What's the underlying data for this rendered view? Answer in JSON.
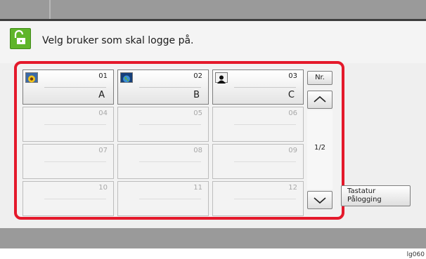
{
  "header": {
    "title": "Velg bruker som skal logge på."
  },
  "tiles": [
    {
      "num": "01",
      "name": "A"
    },
    {
      "num": "02",
      "name": "B"
    },
    {
      "num": "03",
      "name": "C"
    },
    {
      "num": "04",
      "name": ""
    },
    {
      "num": "05",
      "name": ""
    },
    {
      "num": "06",
      "name": ""
    },
    {
      "num": "07",
      "name": ""
    },
    {
      "num": "08",
      "name": ""
    },
    {
      "num": "09",
      "name": ""
    },
    {
      "num": "10",
      "name": ""
    },
    {
      "num": "11",
      "name": ""
    },
    {
      "num": "12",
      "name": ""
    }
  ],
  "avatars": [
    "sunflower-avatar-icon",
    "globe-avatar-icon",
    "person-silhouette-avatar-icon"
  ],
  "side": {
    "nr_label": "Nr.",
    "page_indicator": "1/2"
  },
  "keyboard_login": {
    "line1": "Tastatur",
    "line2": "Pålogging"
  },
  "footer": {
    "image_id": "lg060"
  },
  "colors": {
    "lock_green": "#5fb52a",
    "highlight_red": "#e4192b"
  }
}
